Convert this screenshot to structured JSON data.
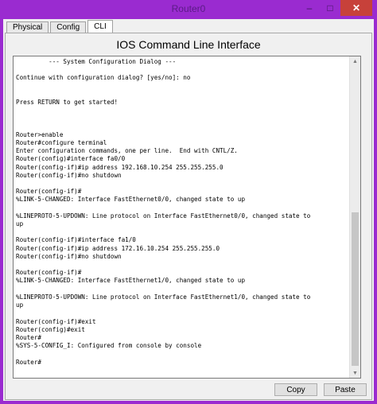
{
  "window": {
    "title": "Router0",
    "minimize_symbol": "–",
    "maximize_symbol": "□",
    "close_symbol": "✕"
  },
  "tabs": [
    {
      "label": "Physical",
      "active": false
    },
    {
      "label": "Config",
      "active": false
    },
    {
      "label": "CLI",
      "active": true
    }
  ],
  "panel": {
    "title": "IOS Command Line Interface"
  },
  "console": {
    "lines": [
      "         --- System Configuration Dialog ---",
      "",
      "Continue with configuration dialog? [yes/no]: no",
      "",
      "",
      "Press RETURN to get started!",
      "",
      "",
      "",
      "Router>enable",
      "Router#configure terminal",
      "Enter configuration commands, one per line.  End with CNTL/Z.",
      "Router(config)#interface fa0/0",
      "Router(config-if)#ip address 192.168.10.254 255.255.255.0",
      "Router(config-if)#no shutdown",
      "",
      "Router(config-if)#",
      "%LINK-5-CHANGED: Interface FastEthernet0/0, changed state to up",
      "",
      "%LINEPROTO-5-UPDOWN: Line protocol on Interface FastEthernet0/0, changed state to",
      "up",
      "",
      "Router(config-if)#interface fa1/0",
      "Router(config-if)#ip address 172.16.10.254 255.255.255.0",
      "Router(config-if)#no shutdown",
      "",
      "Router(config-if)#",
      "%LINK-5-CHANGED: Interface FastEthernet1/0, changed state to up",
      "",
      "%LINEPROTO-5-UPDOWN: Line protocol on Interface FastEthernet1/0, changed state to",
      "up",
      "",
      "Router(config-if)#exit",
      "Router(config)#exit",
      "Router#",
      "%SYS-5-CONFIG_I: Configured from console by console",
      "",
      "Router#"
    ],
    "scroll_position": 0.95
  },
  "buttons": {
    "copy": "Copy",
    "paste": "Paste"
  },
  "colors": {
    "window_frame": "#9a2bd0",
    "close_button": "#c7413a",
    "client_background": "#f0f0f0",
    "console_background": "#ffffff"
  },
  "icons": {
    "scroll_up": "scroll-up-arrow-icon",
    "scroll_down": "scroll-down-arrow-icon"
  }
}
